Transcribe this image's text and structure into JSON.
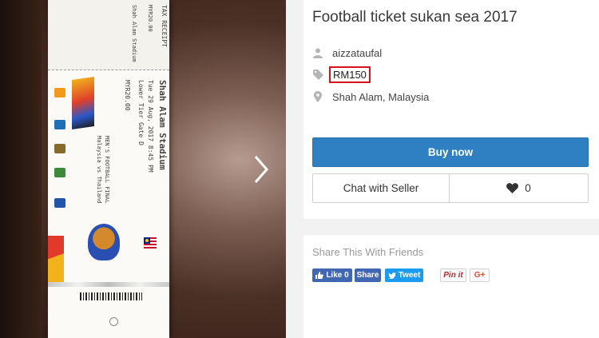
{
  "listing": {
    "title": "Football ticket sukan sea 2017",
    "seller": "aizzataufal",
    "price": "RM150",
    "location": "Shah Alam, Malaysia",
    "buy_label": "Buy now",
    "chat_label": "Chat with Seller",
    "like_count": "0"
  },
  "share": {
    "heading": "Share This With Friends",
    "fb_like": "Like 0",
    "fb_share": "Share",
    "tweet": "Tweet",
    "pin": "Pin it",
    "gplus": "G+"
  },
  "ticket": {
    "stadium": "Shah Alam Stadium",
    "event": "MEN'S FOOTBALL FINAL",
    "match": "Malaysia vs Thailand",
    "date": "Tue 29 Aug, 2017 8:45 PM",
    "tier": "Lower Tier Gate D",
    "price": "MYR20.00",
    "receipt": "TAX RECEIPT"
  },
  "icons": {
    "seller": "user-icon",
    "price": "tag-icon",
    "location": "map-pin-icon",
    "like": "heart-icon",
    "next": "chevron-right-icon"
  },
  "colors": {
    "accent": "#2f80c3",
    "highlight": "#d6111a",
    "facebook": "#4267b2",
    "twitter": "#1d9bf0"
  }
}
